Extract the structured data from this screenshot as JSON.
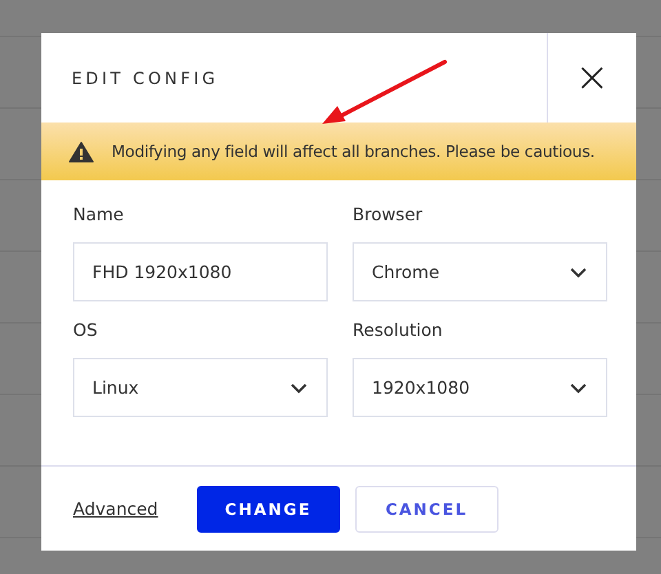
{
  "dialog": {
    "title": "EDIT CONFIG",
    "close": "×",
    "warning": "Modifying any field will affect all branches. Please be cautious.",
    "fields": [
      {
        "kind": "text",
        "label": "Name",
        "value": "FHD 1920x1080"
      },
      {
        "kind": "select",
        "label": "Browser",
        "value": "Chrome"
      },
      {
        "kind": "select",
        "label": "OS",
        "value": "Linux"
      },
      {
        "kind": "select",
        "label": "Resolution",
        "value": "1920x1080"
      }
    ],
    "footer": {
      "link": "Advanced",
      "buttons": [
        {
          "kind": "primary",
          "label": "CHANGE"
        },
        {
          "kind": "secondary",
          "label": "CANCEL"
        }
      ]
    }
  }
}
